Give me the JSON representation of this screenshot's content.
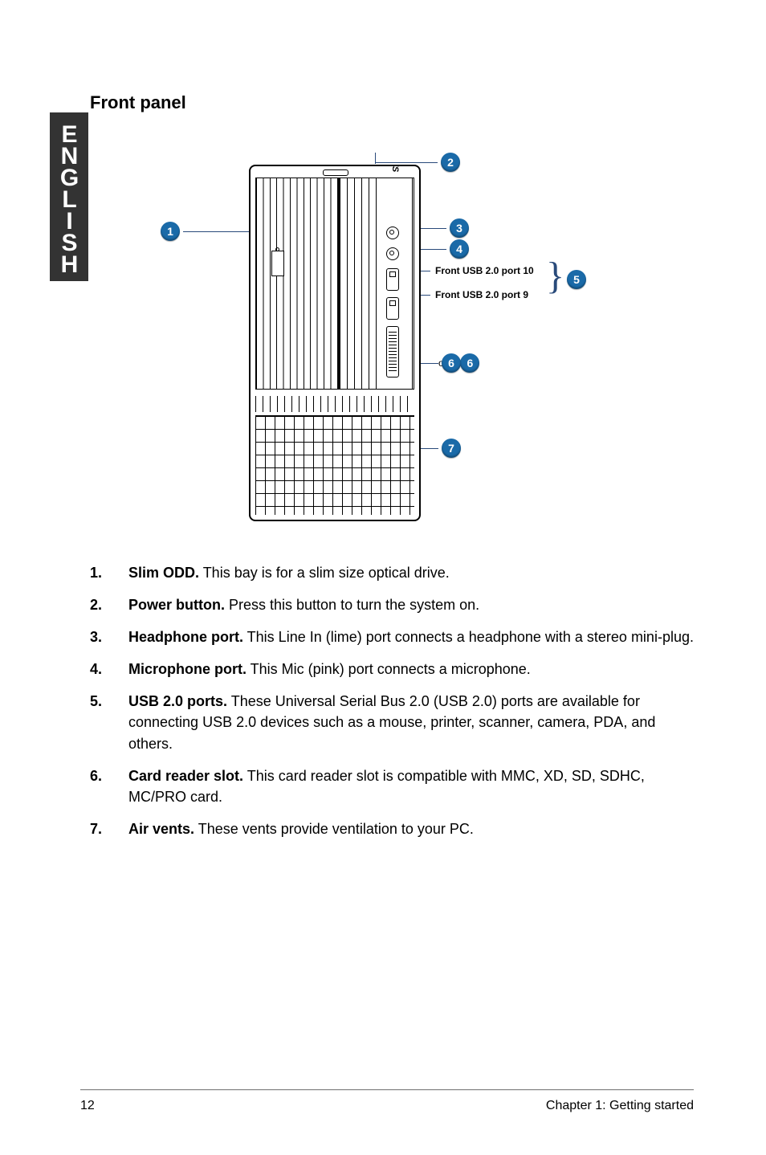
{
  "sidebar": {
    "language": "ENGLISH"
  },
  "title": "Front panel",
  "diagram": {
    "callouts": {
      "c1": "1",
      "c2": "2",
      "c3": "3",
      "c4": "4",
      "c5": "5",
      "c6": "6",
      "c7": "7"
    },
    "usb_labels": {
      "top": "Front USB 2.0 port 10",
      "bottom": "Front USB 2.0 port 9"
    }
  },
  "list": [
    {
      "num": "1.",
      "bold": "Slim ODD.",
      "rest": " This bay is for a slim size optical drive."
    },
    {
      "num": "2.",
      "bold": "Power button.",
      "rest": " Press this button to turn the system on."
    },
    {
      "num": "3.",
      "bold": "Headphone port.",
      "rest": " This Line In (lime) port connects a headphone with a stereo mini-plug."
    },
    {
      "num": "4.",
      "bold": "Microphone port.",
      "rest": " This Mic (pink) port connects a microphone."
    },
    {
      "num": "5.",
      "bold": "USB 2.0 ports.",
      "rest": " These Universal Serial Bus 2.0 (USB 2.0) ports are available for connecting USB 2.0 devices such as a mouse, printer, scanner, camera, PDA, and others."
    },
    {
      "num": "6.",
      "bold": "Card reader slot.",
      "rest": " This card reader slot is compatible with MMC, XD, SD, SDHC, MC/PRO card."
    },
    {
      "num": "7.",
      "bold": "Air vents.",
      "rest": " These vents provide ventilation to your PC."
    }
  ],
  "footer": {
    "page": "12",
    "chapter": "Chapter 1: Getting started"
  }
}
